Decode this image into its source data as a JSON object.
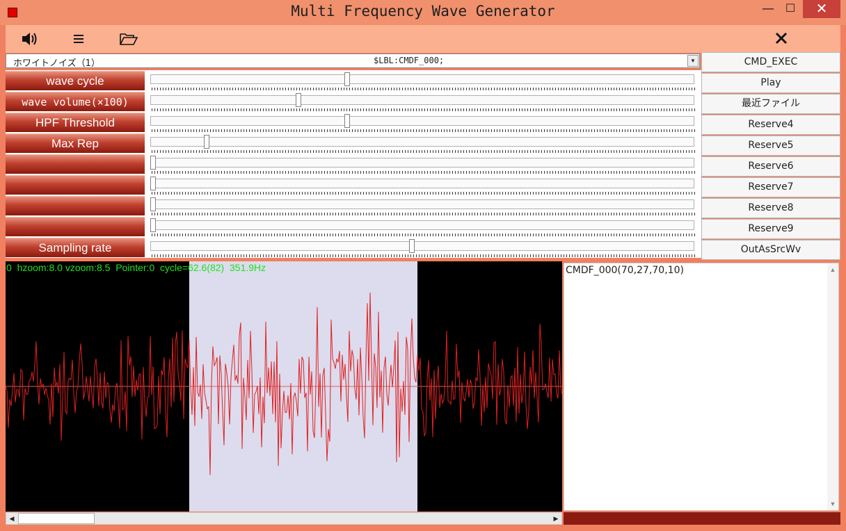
{
  "window": {
    "title": "Multi Frequency Wave Generator",
    "minimize": "—",
    "maximize": "☐",
    "close": "✕"
  },
  "toolbar": {
    "icons": [
      "speaker-icon",
      "menu-icon",
      "folder-open-icon",
      "close-icon"
    ]
  },
  "combo": {
    "left_text": "ホワイトノイズ（1）",
    "center_text": "$LBL:CMDF_000;",
    "arrow": "▼"
  },
  "params": [
    {
      "label": "wave cycle",
      "value": 0.36
    },
    {
      "label": "wave volume(×100)",
      "value": 0.27
    },
    {
      "label": "HPF Threshold",
      "value": 0.36
    },
    {
      "label": "Max Rep",
      "value": 0.1
    },
    {
      "label": "",
      "value": 0.0
    },
    {
      "label": "",
      "value": 0.0
    },
    {
      "label": "",
      "value": 0.0
    },
    {
      "label": "",
      "value": 0.0
    },
    {
      "label": "Sampling rate",
      "value": 0.48
    }
  ],
  "buttons": [
    "CMD_EXEC",
    "Play",
    "最近ファイル",
    "Reserve4",
    "Reserve5",
    "Reserve6",
    "Reserve7",
    "Reserve8",
    "Reserve9",
    "OutAsSrcWv"
  ],
  "wave": {
    "status": "0  hzoom:8.0 vzoom:8.5  Pointer:0  cycle=62.6(82)  351.9Hz",
    "selection_start": 0.33,
    "selection_end": 0.74,
    "wave_color": "#e02020",
    "selection_color": "#dcdcee"
  },
  "text_area": {
    "content": "CMDF_000(70,27,70,10)",
    "scroll_up": "▲",
    "scroll_down": "▼"
  },
  "hscroll": {
    "left": "◀",
    "right": "▶"
  }
}
